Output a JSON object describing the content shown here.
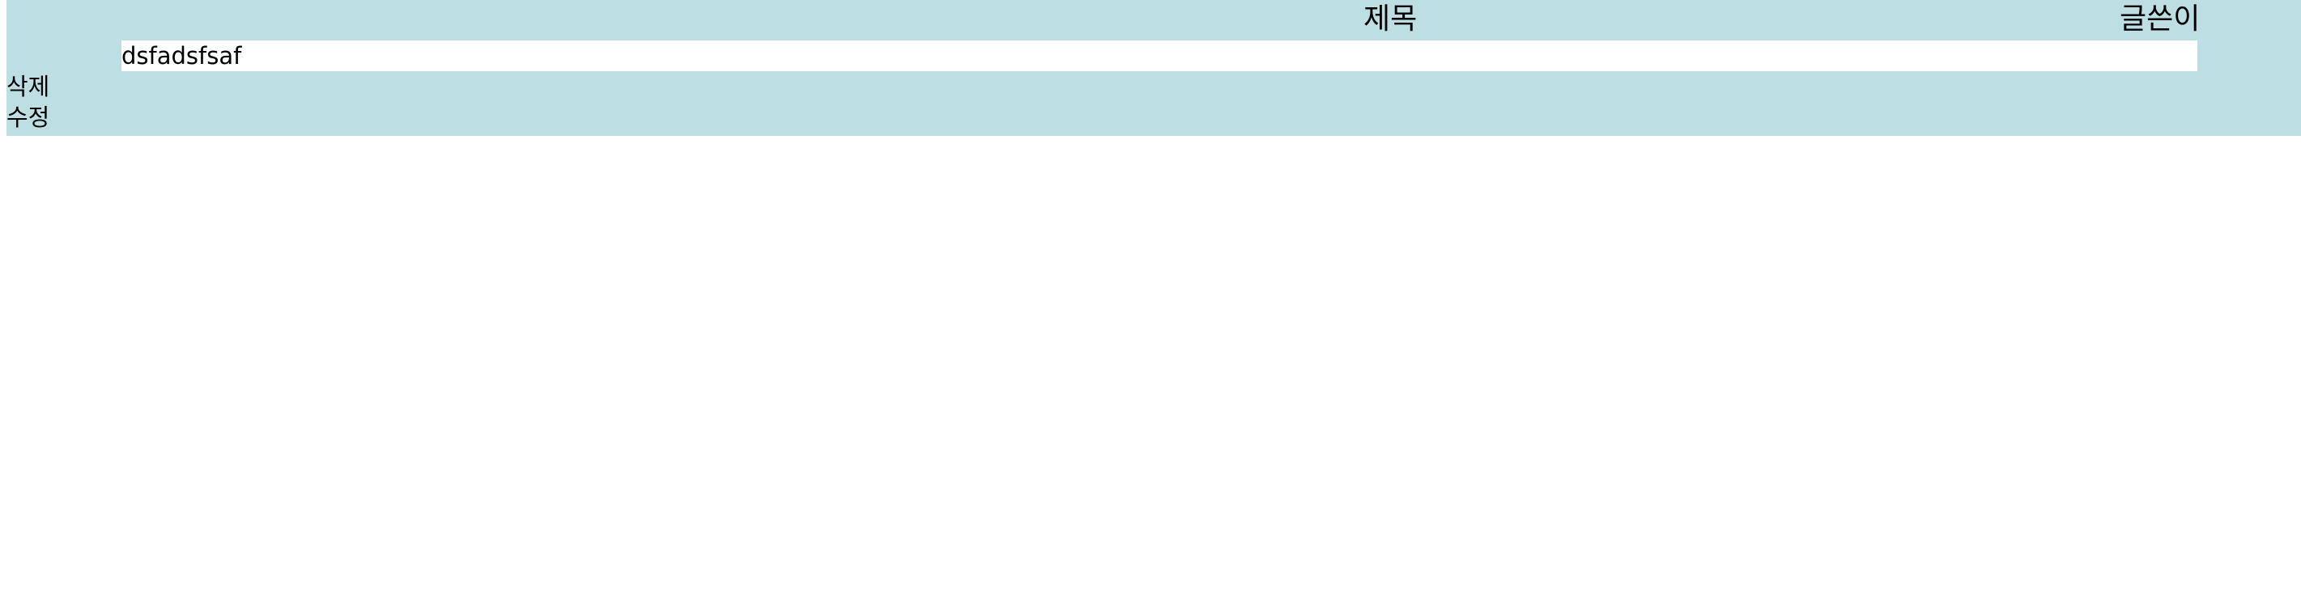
{
  "board": {
    "columns": {
      "title": "제목",
      "author": "글쓴이"
    },
    "post": {
      "title": "dsfadsfsaf",
      "author": ""
    },
    "actions": {
      "delete_label": "삭제",
      "edit_label": "수정"
    }
  },
  "colors": {
    "panel_background": "#bddfe4",
    "row_background": "#ffffff",
    "text": "#000000"
  }
}
